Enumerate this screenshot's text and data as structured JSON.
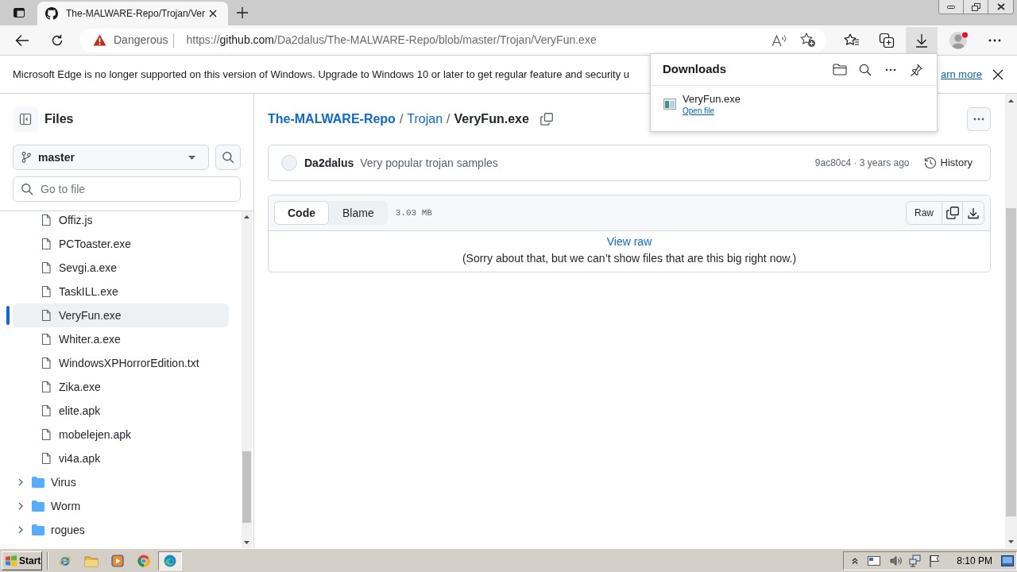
{
  "browser": {
    "tabs": [
      {
        "title": "The-MALWARE-Repo/Trojan/Ver",
        "selected": true
      }
    ],
    "address_bar": {
      "security": "Dangerous",
      "url": {
        "scheme": "https://",
        "host": "github.com",
        "path": "/Da2dalus/The-MALWARE-Repo/blob/master/Trojan/VeryFun.exe"
      }
    },
    "toolbar": {
      "downloads_open": true
    },
    "info_bar": {
      "message": "Microsoft Edge is no longer supported on this version of Windows. Upgrade to Windows 10 or later to get regular feature and security u",
      "link": "arn more"
    }
  },
  "downloads_panel": {
    "title": "Downloads",
    "items": [
      {
        "file_name": "VeryFun.exe",
        "action": "Open file"
      }
    ]
  },
  "sidebar": {
    "title": "Files",
    "branch": "master",
    "file_search": {
      "placeholder": "Go to file"
    },
    "tree": [
      {
        "children": [
          {
            "kind": "file",
            "label": "Offiz.js",
            "selected": false
          },
          {
            "kind": "file",
            "label": "PCToaster.exe",
            "selected": false
          },
          {
            "kind": "file",
            "label": "Sevgi.a.exe",
            "selected": false
          },
          {
            "kind": "file",
            "label": "TaskILL.exe",
            "selected": false
          },
          {
            "kind": "file",
            "label": "VeryFun.exe",
            "selected": true
          },
          {
            "kind": "file",
            "label": "Whiter.a.exe",
            "selected": false
          },
          {
            "kind": "file",
            "label": "WindowsXPHorrorEdition.txt",
            "selected": false
          },
          {
            "kind": "file",
            "label": "Zika.exe",
            "selected": false
          },
          {
            "kind": "file",
            "label": "elite.apk",
            "selected": false
          },
          {
            "kind": "file",
            "label": "mobelejen.apk",
            "selected": false
          },
          {
            "kind": "file",
            "label": "vi4a.apk",
            "selected": false
          }
        ]
      },
      {
        "kind": "folder",
        "label": "Virus",
        "selected": false,
        "expanded": false
      },
      {
        "kind": "folder",
        "label": "Worm",
        "selected": false,
        "expanded": false
      },
      {
        "kind": "folder",
        "label": "rogues",
        "selected": false,
        "expanded": false
      }
    ]
  },
  "breadcrumb": [
    {
      "kind": "link",
      "label": "The-MALWARE-Repo"
    },
    {
      "kind": "separator",
      "label": "/"
    },
    {
      "kind": "link",
      "label": "Trojan"
    },
    {
      "kind": "separator",
      "label": "/"
    },
    {
      "kind": "current",
      "label": "VeryFun.exe"
    }
  ],
  "commit": {
    "author": "Da2dalus",
    "message": "Very popular trojan samples",
    "meta": "9ac80c4 · 3 years ago",
    "history_label": "History"
  },
  "file_view": {
    "modes": [
      {
        "label": "Code",
        "selected": true
      },
      {
        "label": "Blame",
        "selected": false
      }
    ],
    "size": "3.03 MB",
    "raw_label": "Raw",
    "view_raw_link": "View raw",
    "notice": "(Sorry about that, but we can’t show files that are this big right now.)"
  },
  "taskbar": {
    "start_label": "Start",
    "apps": [
      {
        "kind": "ie",
        "selected": false
      },
      {
        "kind": "explorer",
        "selected": false
      },
      {
        "kind": "media-player",
        "selected": false
      },
      {
        "kind": "chrome",
        "selected": false
      },
      {
        "kind": "edge",
        "selected": true
      }
    ],
    "clock": "8:10 PM"
  }
}
